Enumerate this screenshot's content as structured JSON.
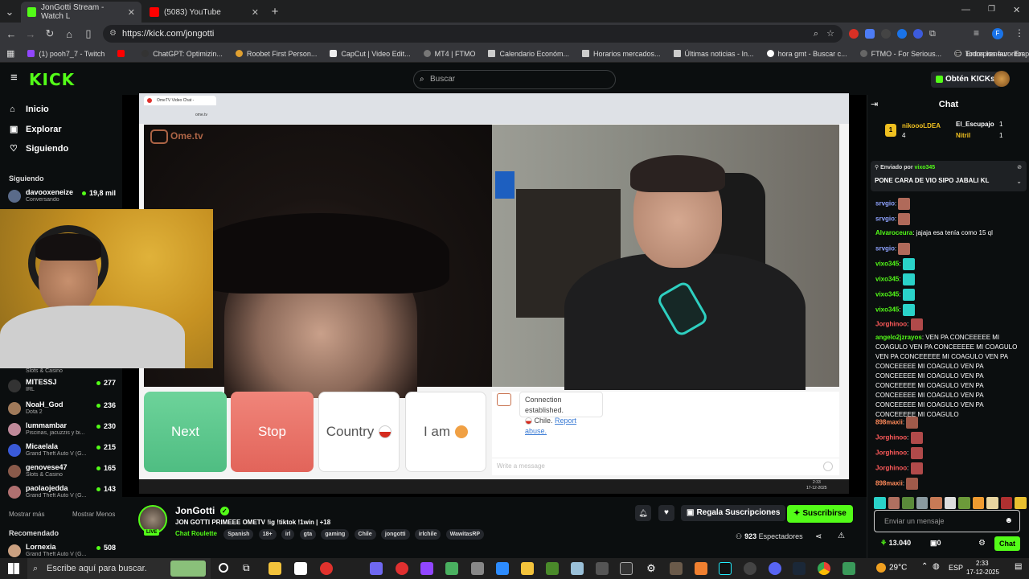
{
  "browser": {
    "tabs": [
      {
        "label": "JonGotti Stream - Watch L",
        "active": true
      },
      {
        "label": "(5083) YouTube",
        "active": false
      }
    ],
    "url": "https://kick.com/jongotti",
    "bookmarks": [
      "(1) pooh7_7 - Twitch",
      "ChatGPT: Optimizin...",
      "Roobet First Person...",
      "CapCut | Video Edit...",
      "MT4 | FTMO",
      "Calendario Económ...",
      "Horarios mercados...",
      "Últimas noticias - In...",
      "hora gmt - Buscar c...",
      "FTMO - For Serious...",
      "Entrepreneur - Empi..."
    ],
    "bookmarks_folder": "Todos los favoritos",
    "profile_initial": "F"
  },
  "header": {
    "logo": "KICK",
    "search_placeholder": "Buscar",
    "get_kicks": "Obtén KICKs"
  },
  "sidebar": {
    "nav": [
      {
        "label": "Inicio",
        "icon": "home-icon"
      },
      {
        "label": "Explorar",
        "icon": "compass-icon"
      },
      {
        "label": "Siguiendo",
        "icon": "heart-icon"
      }
    ],
    "following_title": "Siguiendo",
    "first_channel": {
      "name": "davooxeneize",
      "category": "Conversando",
      "viewers": "19,8 mil"
    },
    "channels": [
      {
        "name": "MITESSJ",
        "category": "IRL",
        "viewers": "277"
      },
      {
        "name": "NoaH_God",
        "category": "Dota 2",
        "viewers": "236"
      },
      {
        "name": "lummambar",
        "category": "Piscinas, jacuzzis y bi...",
        "viewers": "230"
      },
      {
        "name": "Micaelala",
        "category": "Grand Theft Auto V (G...",
        "viewers": "215"
      },
      {
        "name": "genovese47",
        "category": "Slots & Casino",
        "viewers": "165"
      },
      {
        "name": "paolaojedda",
        "category": "Grand Theft Auto V (G...",
        "viewers": "143"
      }
    ],
    "hidden_category": "Slots & Casino",
    "show_more": "Mostrar más",
    "show_less": "Mostrar Menos",
    "recommended_title": "Recomendado",
    "recommended": [
      {
        "name": "Lornexia",
        "category": "Grand Theft Auto V (G...",
        "viewers": "508"
      }
    ]
  },
  "ometv": {
    "tab_label": "OmeTV Video Chat -",
    "url": "ome.tv",
    "logo": "Ome.tv",
    "buttons": {
      "next": "Next",
      "stop": "Stop",
      "country": "Country",
      "iam": "I am"
    },
    "connection_msg": "Connection established.",
    "country_line": "Chile.",
    "report": "Report abuse.",
    "message_placeholder": "Write a message",
    "inner_clock_time": "2:33",
    "inner_clock_date": "17-12-2025"
  },
  "stream": {
    "streamer": "JonGotti",
    "title": "JON GOTTI PRIMEEE OMETV !ig !tiktok !1win | +18",
    "category": "Chat Roulette",
    "tags": [
      "Spanish",
      "18+",
      "irl",
      "gta",
      "gaming",
      "Chile",
      "jongotti",
      "irlchile",
      "WawitasRP"
    ],
    "live_badge": "LIVE",
    "gift_subs": "Regala Suscripciones",
    "subscribe": "Suscribirse",
    "viewers": "923",
    "viewers_label": "Espectadores"
  },
  "chat": {
    "title": "Chat",
    "leaderboard": [
      {
        "name": "nikoooLDEA",
        "count": "4"
      },
      {
        "name": "El_Escupajo",
        "count": "1"
      },
      {
        "name": "Nitril",
        "count": "1"
      }
    ],
    "pinned_by_label": "Enviado por",
    "pinned_by": "vixo345",
    "pinned_text": "PONE CARA DE VIO SIPO JABALI KL",
    "messages": [
      {
        "user": "srvgio",
        "color": "#8fa3ff",
        "text": ""
      },
      {
        "user": "srvgio",
        "color": "#8fa3ff",
        "text": ""
      },
      {
        "user": "Alvaroceura",
        "color": "#53fc18",
        "text": "jajaja esa tenía como 15 ql"
      },
      {
        "user": "srvgio",
        "color": "#8fa3ff",
        "text": ""
      },
      {
        "user": "vixo345",
        "color": "#53fc18",
        "text": ""
      },
      {
        "user": "vixo345",
        "color": "#53fc18",
        "text": ""
      },
      {
        "user": "vixo345",
        "color": "#53fc18",
        "text": ""
      },
      {
        "user": "vixo345",
        "color": "#53fc18",
        "text": ""
      },
      {
        "user": "Jorghinoo",
        "color": "#ff5a5a",
        "text": ""
      },
      {
        "user": "angelo2jzrayos",
        "color": "#53fc18",
        "text": "VEN PA CONCEEEEE MI COAGULO VEN PA CONCEEEEE MI COAGULO VEN PA CONCEEEEE MI COAGULO VEN PA CONCEEEEE MI COAGULO VEN PA CONCEEEEE MI COAGULO VEN PA CONCEEEEE MI COAGULO VEN PA CONCEEEEE MI COAGULO VEN PA CONCEEEEE MI COAGULO VEN PA CONCEEEEE MI COAGULO"
      },
      {
        "user": "898maxii",
        "color": "#ff8a5a",
        "text": ""
      },
      {
        "user": "Jorghinoo",
        "color": "#ff5a5a",
        "text": ""
      },
      {
        "user": "Jorghinoo",
        "color": "#ff5a5a",
        "text": ""
      },
      {
        "user": "Jorghinoo",
        "color": "#ff5a5a",
        "text": ""
      },
      {
        "user": "898maxii",
        "color": "#ff8a5a",
        "text": ""
      }
    ],
    "input_placeholder": "Enviar un mensaje",
    "balance": "13.040",
    "gifts": "0",
    "send": "Chat"
  },
  "taskbar": {
    "search_placeholder": "Escribe aquí para buscar.",
    "weather": "29°C",
    "lang": "ESP",
    "time": "2:33",
    "date": "17-12-2025"
  },
  "colors": {
    "kick_green": "#53fc18",
    "bg": "#0b0e0f"
  }
}
